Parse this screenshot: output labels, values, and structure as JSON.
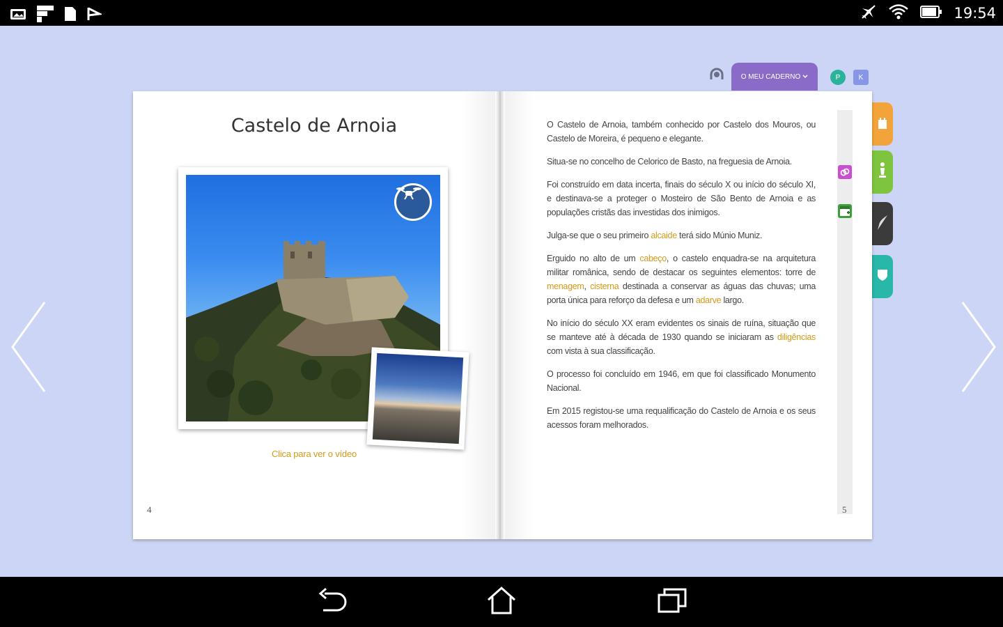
{
  "status_bar": {
    "time": "19:54",
    "left_icons": [
      "gallery-icon",
      "flipboard-icon",
      "file-icon",
      "download-flag-icon"
    ],
    "right_icons": [
      "airplane-mode-icon",
      "wifi-icon",
      "battery-icon"
    ]
  },
  "toolbar": {
    "notebook_label": "O MEU CADERNO",
    "profile_badge": "P",
    "k_badge": "K"
  },
  "left_page": {
    "title": "Castelo de Arnoia",
    "video_link": "Clica para ver o vídeo",
    "page_number": "4"
  },
  "right_page": {
    "page_number": "5",
    "paragraphs": [
      [
        {
          "t": "O Castelo de Arnoia, também conhecido por Castelo dos Mouros, ou Castelo de Moreira, é pequeno e elegante."
        }
      ],
      [
        {
          "t": "Situa-se no concelho de Celorico de Basto, na freguesia de Arnoia."
        }
      ],
      [
        {
          "t": "Foi construído em data incerta, finais do século X ou início do século XI,  e destinava-se a proteger o Mosteiro de São Bento de Arnoia e as populações cristãs das investidas dos inimigos."
        }
      ],
      [
        {
          "t": "Julga-se que o seu primeiro "
        },
        {
          "t": "alcaide",
          "hl": true
        },
        {
          "t": " terá sido Múnio Muniz."
        }
      ],
      [
        {
          "t": "Erguido no alto de um "
        },
        {
          "t": "cabeço",
          "hl": true
        },
        {
          "t": ", o castelo enquadra-se na arquitetura militar românica, sendo de destacar os seguintes elementos: torre de "
        },
        {
          "t": "menagem",
          "hl": true
        },
        {
          "t": ", "
        },
        {
          "t": "cisterna",
          "hl": true
        },
        {
          "t": " destinada a conservar as águas das chuvas; uma porta única para reforço da defesa e um "
        },
        {
          "t": "adarve",
          "hl": true
        },
        {
          "t": " largo."
        }
      ],
      [
        {
          "t": "No início do século XX eram evidentes os sinais de ruína, situação que se manteve até à década de 1930 quando se iniciaram as "
        },
        {
          "t": "diligências",
          "hl": true
        },
        {
          "t": " com vista à sua classificação."
        }
      ],
      [
        {
          "t": "O processo foi concluído em 1946,  em que foi classificado Monumento Nacional."
        }
      ],
      [
        {
          "t": "Em 2015 registou-se uma requalificação do Castelo de Arnoia e os seus acessos foram melhorados."
        }
      ]
    ]
  },
  "side_tabs": [
    {
      "name": "castle",
      "color": "#f2a43a"
    },
    {
      "name": "chess-piece",
      "color": "#7ec43f"
    },
    {
      "name": "feather",
      "color": "#3b3b3b"
    },
    {
      "name": "shield",
      "color": "#28b7a8"
    }
  ],
  "colors": {
    "background": "#cdd5f6",
    "highlight": "#d49a18",
    "notebook": "#8a6cc8",
    "profile_badge": "#2bb39a",
    "k_badge": "#8896e8"
  }
}
